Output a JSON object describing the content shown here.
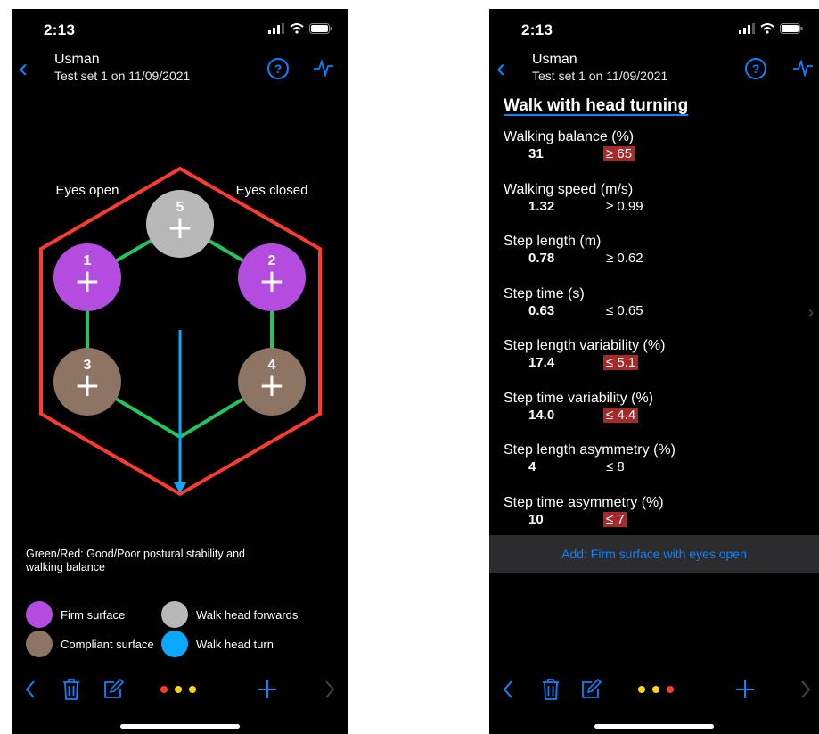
{
  "status": {
    "time": "2:13"
  },
  "nav": {
    "name": "Usman",
    "subtitle": "Test set 1 on 11/09/2021",
    "help_label": "?"
  },
  "left": {
    "labels": {
      "eyes_open": "Eyes open",
      "eyes_closed": "Eyes closed"
    },
    "tests": [
      {
        "number": "1",
        "symbol": "+",
        "surface": "firm"
      },
      {
        "number": "2",
        "symbol": "+",
        "surface": "firm"
      },
      {
        "number": "3",
        "symbol": "+",
        "surface": "compliant"
      },
      {
        "number": "4",
        "symbol": "+",
        "surface": "compliant"
      },
      {
        "number": "5",
        "symbol": "+",
        "surface": "walk-forwards"
      }
    ],
    "legend_text": "Green/Red: Good/Poor postural stability and walking balance",
    "legend": {
      "firm": "Firm surface",
      "compliant": "Compliant surface",
      "walk_forwards": "Walk head forwards",
      "walk_turn": "Walk head turn"
    },
    "colors": {
      "firm": "#b44ddf",
      "compliant": "#8d7463",
      "forwards": "#b8b8b8",
      "turn": "#0aa8ff",
      "good": "#22c55e",
      "poor": "#ff3b30"
    }
  },
  "right": {
    "title": "Walk with head turning",
    "metrics": [
      {
        "label": "Walking balance (%)",
        "value": "31",
        "threshold": "≥ 65",
        "poor": true
      },
      {
        "label": "Walking speed (m/s)",
        "value": "1.32",
        "threshold": "≥ 0.99",
        "poor": false
      },
      {
        "label": "Step length (m)",
        "value": "0.78",
        "threshold": "≥ 0.62",
        "poor": false
      },
      {
        "label": "Step time (s)",
        "value": "0.63",
        "threshold": "≤ 0.65",
        "poor": false
      },
      {
        "label": "Step length variability (%)",
        "value": "17.4",
        "threshold": "≤ 5.1",
        "poor": true
      },
      {
        "label": "Step time variability (%)",
        "value": "14.0",
        "threshold": "≤ 4.4",
        "poor": true
      },
      {
        "label": "Step length asymmetry (%)",
        "value": "4",
        "threshold": "≤ 8",
        "poor": false
      },
      {
        "label": "Step time asymmetry (%)",
        "value": "10",
        "threshold": "≤ 7",
        "poor": true
      }
    ],
    "add_button": "Add: Firm surface with eyes open"
  },
  "toolbar": {
    "dot_colors": [
      "#ff3b30",
      "#ffd60a",
      "#ffd60a",
      "#ff3b30"
    ]
  }
}
